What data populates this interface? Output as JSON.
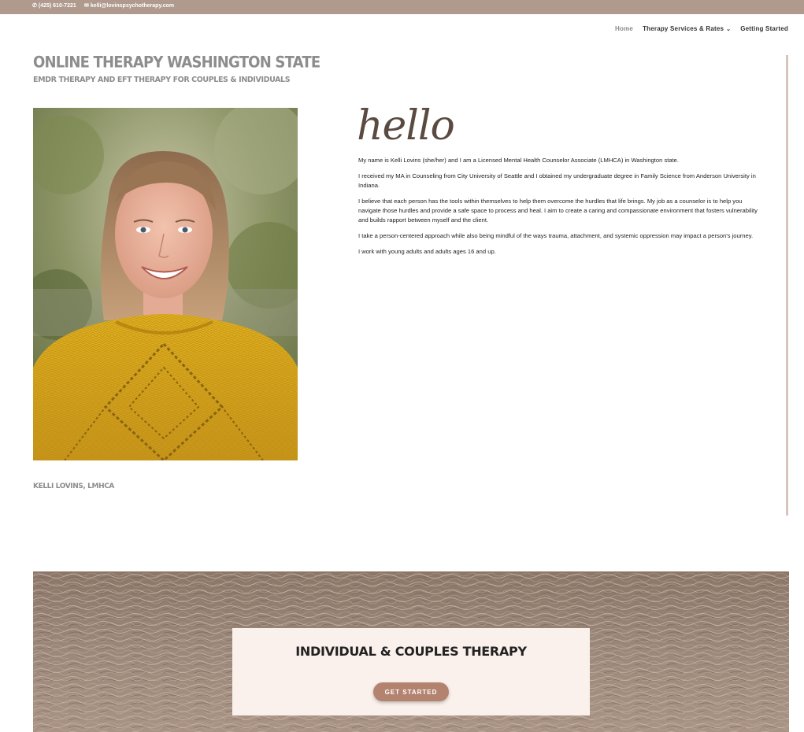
{
  "topbar": {
    "phone": "(425) 610-7221",
    "email": "kelli@lovinspsychotherapy.com",
    "phone_icon": "phone-icon",
    "email_icon": "envelope-icon",
    "background": "#b09a8e"
  },
  "nav": {
    "items": [
      {
        "label": "Home",
        "active": true
      },
      {
        "label": "Therapy Services & Rates",
        "has_dropdown": true
      },
      {
        "label": "Getting Started"
      }
    ]
  },
  "header": {
    "title": "ONLINE THERAPY WASHINGTON STATE",
    "subtitle": "EMDR THERAPY AND EFT THERAPY FOR COUPLES & INDIVIDUALS"
  },
  "profile": {
    "caption": "KELLI LOVINS, LMHCA"
  },
  "intro": {
    "greeting": "hello",
    "paragraphs": [
      "My name is Kelli Lovins (she/her) and I am a Licensed Mental Health Counselor Associate (LMHCA) in Washington state.",
      "I received my MA in Counseling from City University of Seattle and I obtained my undergraduate degree in Family Science from Anderson University in Indiana.",
      "I believe that each person has the tools within themselves to help them overcome the hurdles that life brings. My job as a counselor is to help you navigate those hurdles and provide a safe space to process and heal. I aim to create a caring and compassionate environment that fosters vulnerability and builds rapport between myself and the client.",
      "I take a person-centered approach while also being mindful of the ways trauma, attachment, and systemic oppression may impact a person's journey.",
      "I work with young adults and adults ages 16 and up."
    ]
  },
  "banner": {
    "title": "INDIVIDUAL & COUPLES THERAPY",
    "button_label": "GET STARTED",
    "accent": "#b3836f"
  }
}
